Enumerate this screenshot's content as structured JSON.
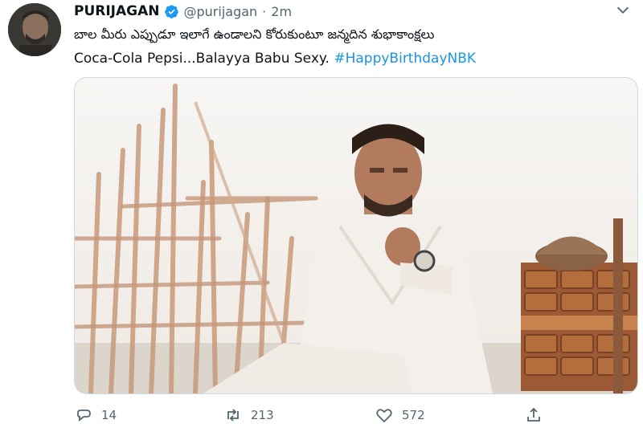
{
  "tweet": {
    "author_name": "PURIJAGAN",
    "handle": "@purijagan",
    "separator": "·",
    "timestamp": "2m",
    "text_line1": "బాల మీరు ఎప్పుడూ ఇలాగే ఉండాలని కోరుకుంటూ జన్మదిన శుభాకాంక్షలు",
    "text_line2": "Coca-Cola Pepsi...Balayya Babu Sexy.",
    "hashtag": "#HappyBirthdayNBK"
  },
  "actions": {
    "reply_count": "14",
    "retweet_count": "213",
    "like_count": "572"
  },
  "icons": {
    "verified": "verified-badge-icon",
    "caret": "chevron-down-icon",
    "reply": "reply-icon",
    "retweet": "retweet-icon",
    "like": "heart-icon",
    "share": "share-icon"
  },
  "colors": {
    "text": "#0f1419",
    "secondary": "#536471",
    "link": "#1b95e0",
    "verified": "#1d9bf0"
  }
}
